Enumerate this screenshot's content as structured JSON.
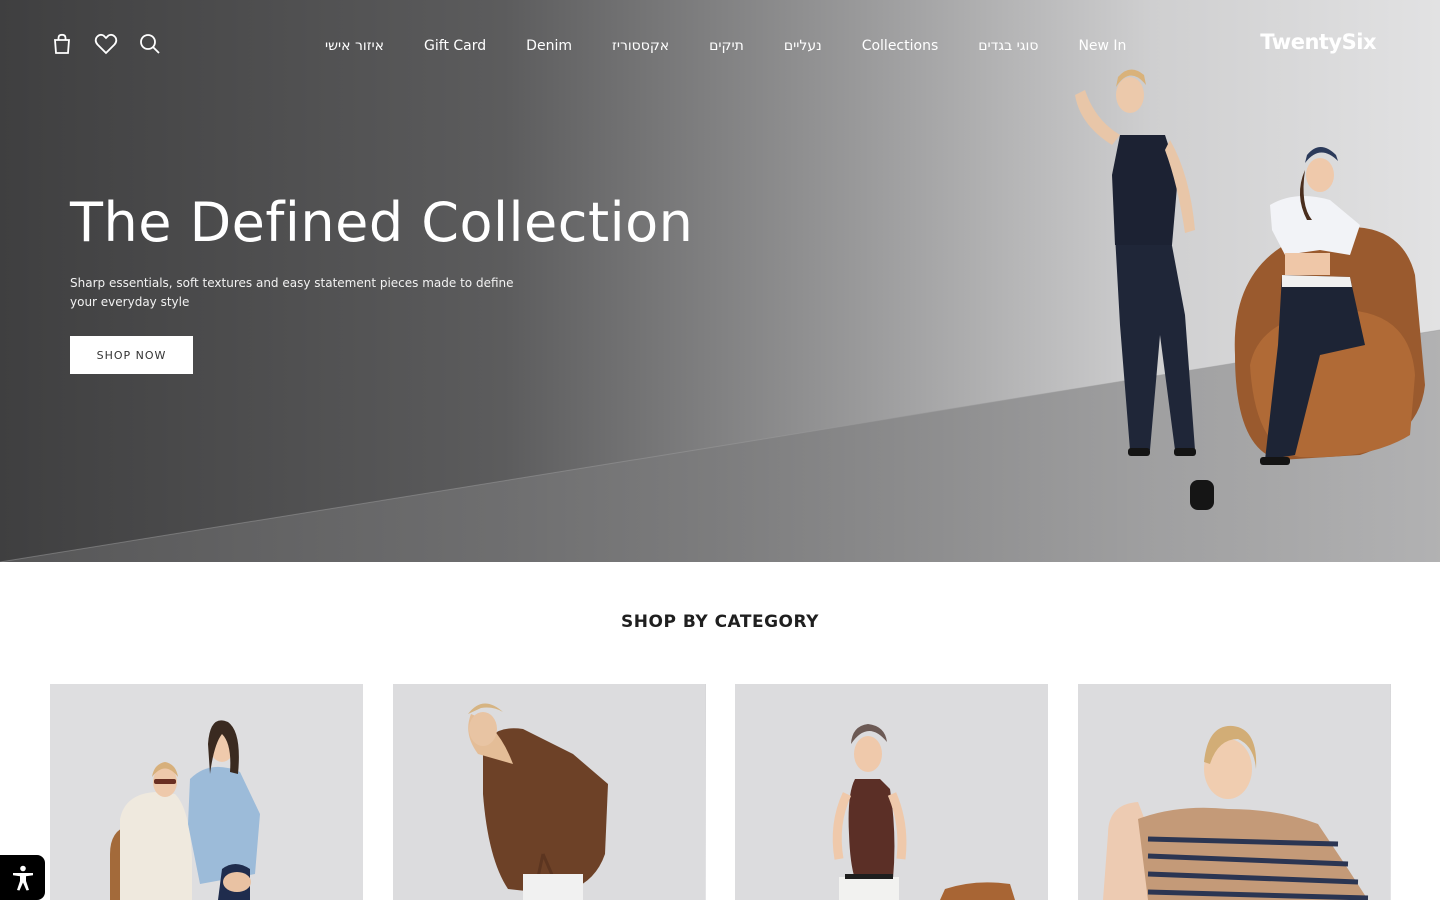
{
  "header": {
    "logo": "TwentySix",
    "icons": [
      "cart-icon",
      "heart-icon",
      "search-icon"
    ],
    "nav": [
      {
        "label": "איזור אישי"
      },
      {
        "label": "Gift Card"
      },
      {
        "label": "Denim"
      },
      {
        "label": "אקססוריז"
      },
      {
        "label": "תיקים"
      },
      {
        "label": "נעליים"
      },
      {
        "label": "Collections"
      },
      {
        "label": "סוגי בגדים"
      },
      {
        "label": "New In"
      }
    ]
  },
  "hero": {
    "title": "The Defined Collection",
    "subtitle": "Sharp essentials, soft textures and easy statement pieces made to define your everyday style",
    "button": "SHOP NOW"
  },
  "categories": {
    "title": "SHOP BY CATEGORY"
  },
  "colors": {
    "text": "#1f1f1f",
    "hero_text": "#ffffff",
    "button_bg": "#ffffff",
    "accessibility_bg": "#000000"
  }
}
